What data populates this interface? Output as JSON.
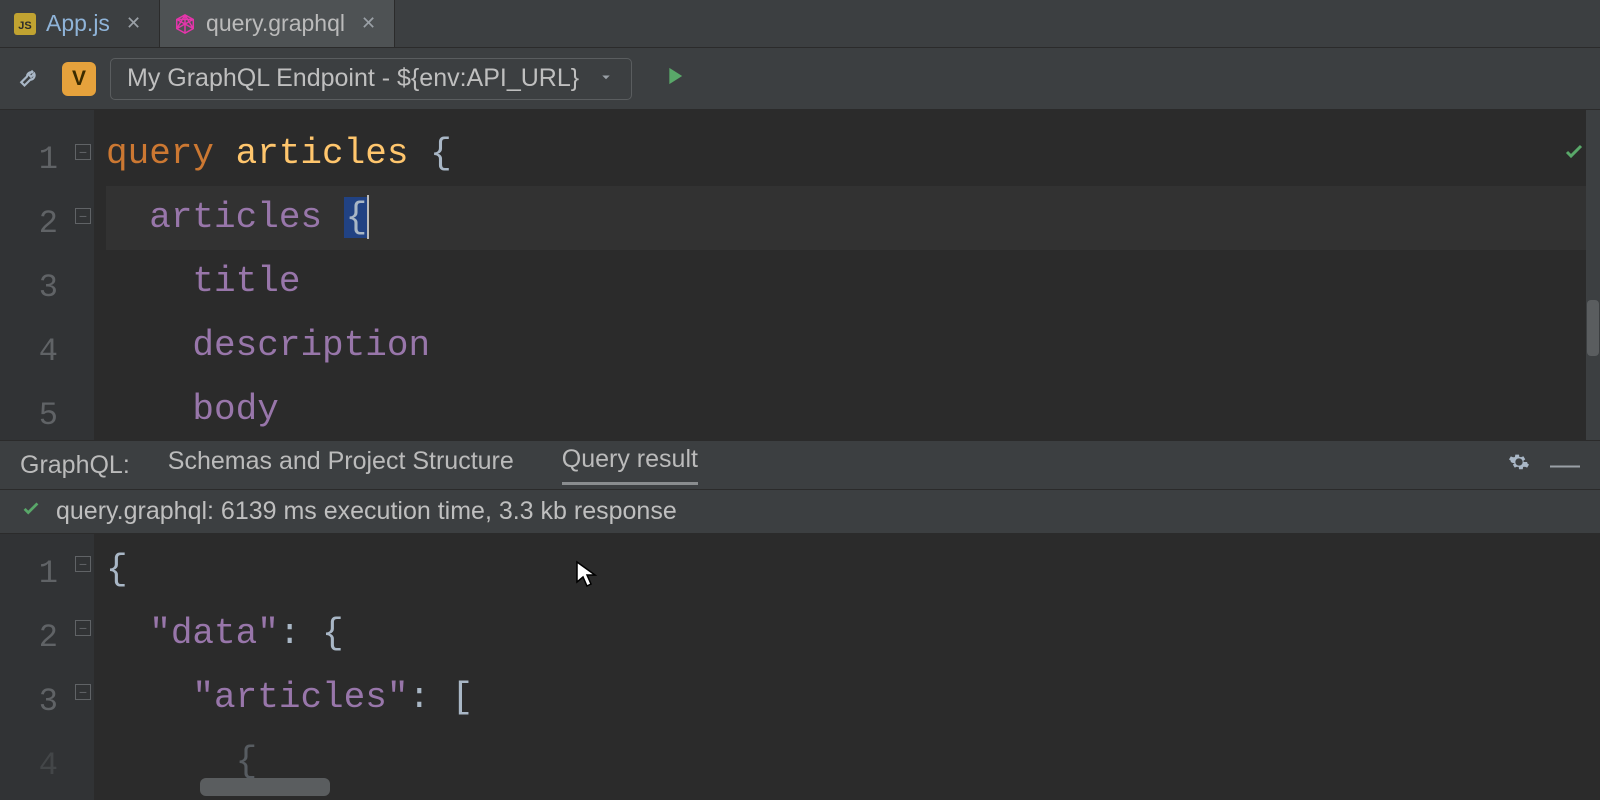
{
  "tabs": [
    {
      "label": "App.js",
      "icon": "js-file-icon"
    },
    {
      "label": "query.graphql",
      "icon": "graphql-file-icon"
    }
  ],
  "toolbar": {
    "env_badge": "V",
    "endpoint_label": "My GraphQL Endpoint - ${env:API_URL}"
  },
  "editor": {
    "line_numbers": [
      "1",
      "2",
      "3",
      "4",
      "5"
    ],
    "tokens": {
      "l1_kw": "query ",
      "l1_name": "articles ",
      "l1_brace": "{",
      "l2_indent": "  ",
      "l2_field": "articles ",
      "l2_brace": "{",
      "l3_indent": "    ",
      "l3_field": "title",
      "l4_indent": "    ",
      "l4_field": "description",
      "l5_indent": "    ",
      "l5_field": "body"
    }
  },
  "panel": {
    "title": "GraphQL:",
    "tab_a": "Schemas and Project Structure",
    "tab_b": "Query result"
  },
  "status_line": "query.graphql: 6139 ms execution time, 3.3 kb response",
  "result": {
    "line_numbers": [
      "1",
      "2",
      "3",
      "4"
    ],
    "tokens": {
      "r1": "{",
      "r2_indent": "  ",
      "r2_key": "\"data\"",
      "r2_rest": ": {",
      "r3_indent": "    ",
      "r3_key": "\"articles\"",
      "r3_rest": ": [",
      "r4_indent": "      ",
      "r4": "{"
    }
  }
}
